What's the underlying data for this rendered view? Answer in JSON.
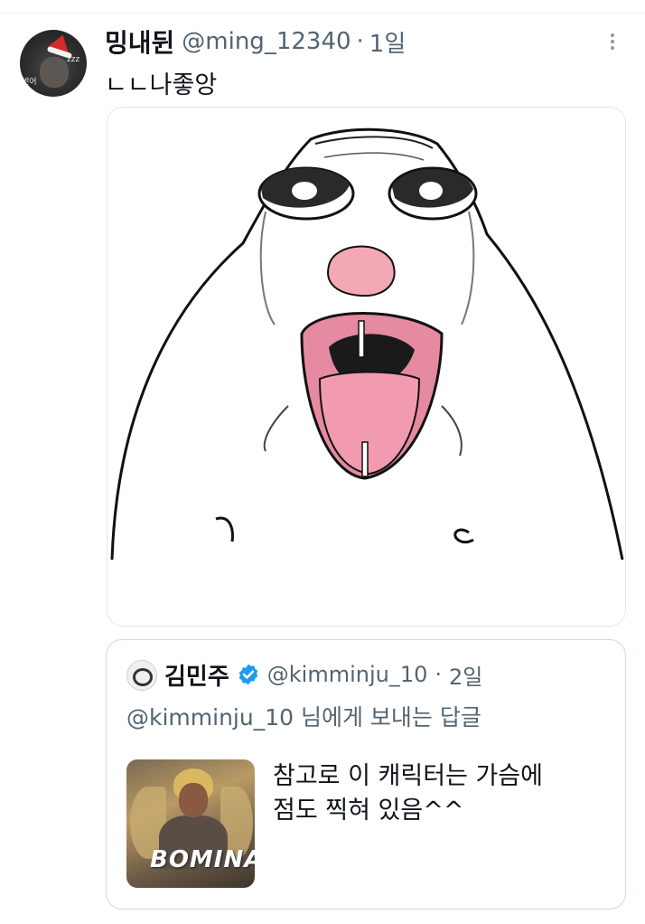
{
  "tweet": {
    "author_name": "밍내뒨",
    "handle": "@ming_12340",
    "separator": "·",
    "time": "1일",
    "text": "ㄴㄴ나좋앙",
    "avatar_label": "썬어",
    "avatar_zz": "zzz",
    "more_icon": "more-vertical-icon"
  },
  "quote": {
    "author_name": "김민주",
    "verified_icon": "verified-badge-icon",
    "handle": "@kimminju_10",
    "separator": "·",
    "time": "2일",
    "reply_to": "@kimminju_10 님에게 보내는 답글",
    "text_line1": "참고로 이 캐릭터는 가슴에",
    "text_line2": "점도 찍혀 있음^^",
    "thumbnail_logo": "BOMINA"
  },
  "colors": {
    "text_primary": "#0f1419",
    "text_secondary": "#536471",
    "border": "#cfd9de",
    "verified": "#1d9bf0",
    "nose": "#f4a7b4",
    "mouth_inner": "#e58aa0",
    "tongue": "#f29bb0"
  }
}
